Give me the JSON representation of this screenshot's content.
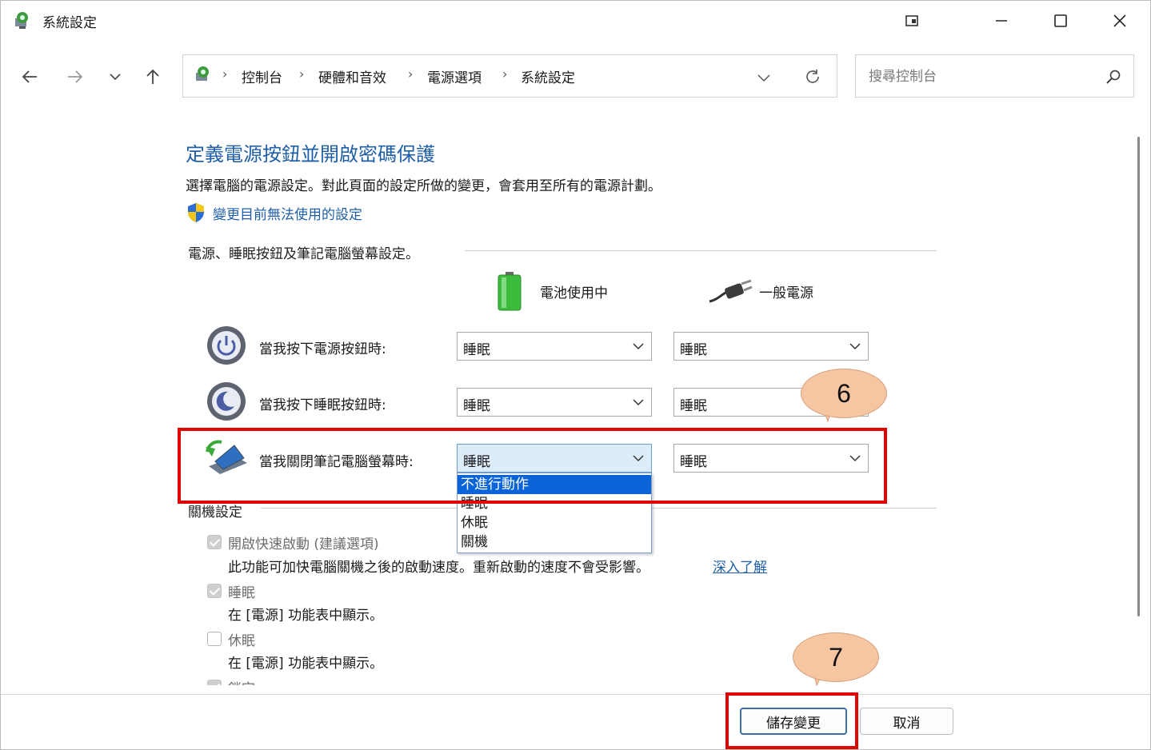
{
  "window": {
    "title": "系統設定"
  },
  "address": {
    "crumbs": [
      "控制台",
      "硬體和音效",
      "電源選項",
      "系統設定"
    ]
  },
  "search": {
    "placeholder": "搜尋控制台"
  },
  "content": {
    "heading": "定義電源按鈕並開啟密碼保護",
    "description": "選擇電腦的電源設定。對此頁面的設定所做的變更，會套用至所有的電源計劃。",
    "change_link": "變更目前無法使用的設定",
    "power_section": "電源、睡眠按鈕及筆記電腦螢幕設定。",
    "battery_header": "電池使用中",
    "ac_header": "一般電源",
    "rows": [
      {
        "label": "當我按下電源按鈕時:",
        "battery": "睡眠",
        "ac": "睡眠"
      },
      {
        "label": "當我按下睡眠按鈕時:",
        "battery": "睡眠",
        "ac": "睡眠"
      },
      {
        "label": "當我關閉筆記電腦螢幕時:",
        "battery": "睡眠",
        "ac": "睡眠"
      }
    ],
    "dropdown_options": [
      "不進行動作",
      "睡眠",
      "休眠",
      "關機"
    ],
    "shutdown_section": "關機設定",
    "fast_startup": {
      "label": "開啟快速啟動 (建議選項)",
      "desc": "此功能可加快電腦關機之後的啟動速度。重新啟動的速度不會受影響。",
      "link": "深入了解",
      "checked": true
    },
    "sleep": {
      "label": "睡眠",
      "desc": "在 [電源] 功能表中顯示。",
      "checked": true
    },
    "hibernate": {
      "label": "休眠",
      "desc": "在 [電源] 功能表中顯示。",
      "checked": false
    },
    "lock_partial": "鎖定"
  },
  "footer": {
    "save_label": "儲存變更",
    "cancel_label": "取消"
  },
  "annotations": {
    "step6": "6",
    "step7": "7"
  },
  "colors": {
    "accent": "#1f5fa8",
    "highlight": "#e00000",
    "bubble": "#f6c5a2",
    "selected": "#0a64d8"
  }
}
